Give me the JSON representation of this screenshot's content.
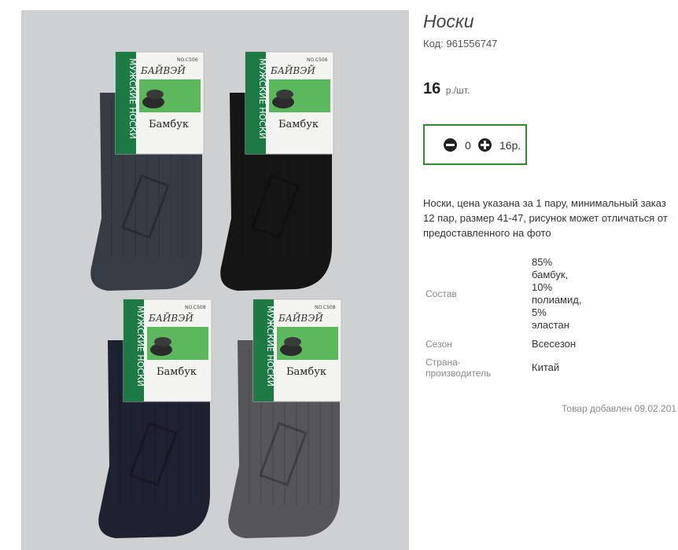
{
  "product": {
    "title": "Носки",
    "code_label": "Код:",
    "code": "961556747",
    "price": "16",
    "price_unit": "р./шт.",
    "description": "Носки, цена указана за 1 пару, минимальный заказ 12 пар, размер 41-47, рисунок может отличаться от предоставленного на фото",
    "added": "Товар добавлен 09.02.201"
  },
  "cart": {
    "quantity": "0",
    "total": "16р."
  },
  "specs": {
    "composition_label": "Состав",
    "composition_lines": [
      "85%",
      "бамбук,",
      "10%",
      "полиамид,",
      "5%",
      "эластан"
    ],
    "season_label": "Сезон",
    "season_value": "Всесезон",
    "country_label_lines": [
      "Страна-",
      "производитель"
    ],
    "country_value": "Китай"
  },
  "photo": {
    "brand": "БАЙВЭЙ",
    "vertical_text": "МУЖСКИЕ НОСКИ",
    "material": "Бамбук",
    "model_top": "NO.C506",
    "model_bottom": "NO.C508",
    "sock_colors": [
      "#363c46",
      "#151515",
      "#1d2130",
      "#565658"
    ],
    "band_color": "#1e7a45"
  }
}
